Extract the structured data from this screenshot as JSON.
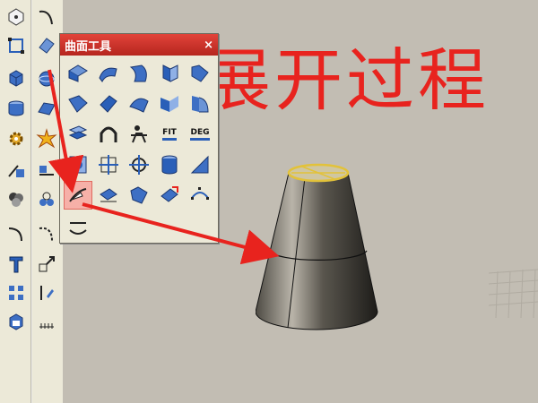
{
  "panel": {
    "title": "曲面工具",
    "close_glyph": "×",
    "fit_label": "FIT",
    "deg_label": "DEG"
  },
  "overlay": {
    "title": "展开过程"
  },
  "colors": {
    "annotation_red": "#e8231e",
    "viewport_bg": "#c2bdb3",
    "toolbar_bg": "#ece9d8",
    "titlebar_red": "#c0302a",
    "icon_blue": "#2a5fb8",
    "cone_edge_yellow": "#e2c23a"
  },
  "icons": {
    "left_toolbar": [
      "point-icon",
      "curve-icon",
      "edit-points-icon",
      "surface-icon",
      "box-solid-icon",
      "sphere-icon",
      "cylinder-icon",
      "surface-edit-icon",
      "gear-transform-icon",
      "explode-icon",
      "trim-icon",
      "split-icon",
      "boolean-icon",
      "group-icon",
      "fillet-icon",
      "blend-icon",
      "text-icon",
      "scale-icon",
      "array-icon",
      "edit-icon",
      "render-icon",
      "dimension-icon"
    ],
    "panel": [
      "loft-icon",
      "sweep1-icon",
      "sweep2-icon",
      "revolve-icon",
      "rail-revolve-icon",
      "edge-surface-icon",
      "network-icon",
      "patch-icon",
      "blend-surface-icon",
      "fillet-surface-icon",
      "offset-surface-icon",
      "extend-surface-icon",
      "chamfer-surface-icon",
      "rebuild-icon",
      "match-surface-icon",
      "arch-icon",
      "person-icon",
      "fit-icon",
      "deg-icon",
      "adjust-seam-icon",
      "uv-curve-icon",
      "drape-icon",
      "cylinder-solid-icon",
      "trim-surface-icon",
      "unroll-icon",
      "smash-icon",
      "flow-icon",
      "shrink-icon",
      "control-points-icon",
      "unroll-curve-icon"
    ]
  }
}
